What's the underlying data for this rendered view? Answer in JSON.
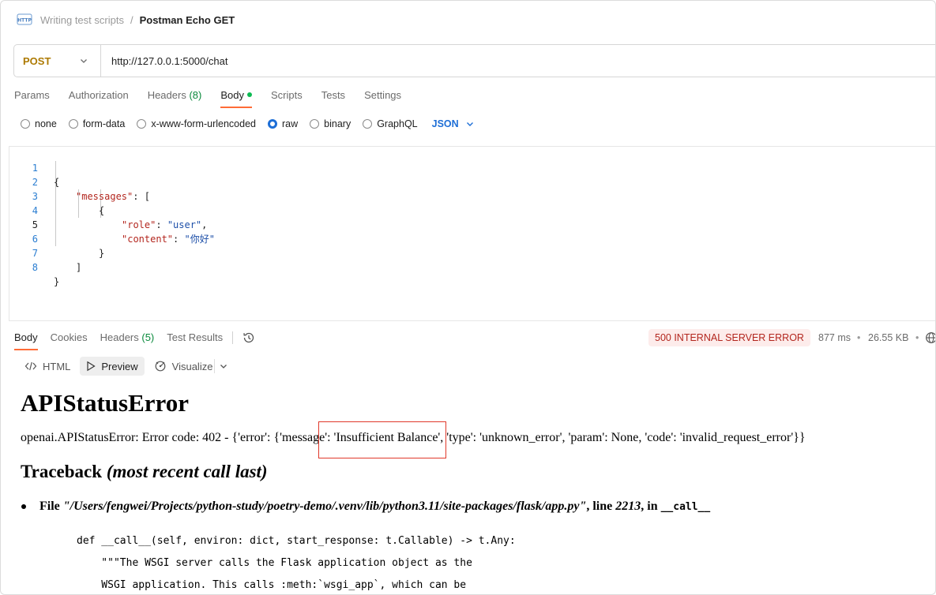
{
  "breadcrumb": {
    "icon": "http-request-icon",
    "collection": "Writing test scripts",
    "separator": "/",
    "request": "Postman Echo GET"
  },
  "request": {
    "method": "POST",
    "url": "http://127.0.0.1:5000/chat"
  },
  "request_tabs": [
    {
      "label": "Params"
    },
    {
      "label": "Authorization"
    },
    {
      "label": "Headers",
      "count": "(8)"
    },
    {
      "label": "Body",
      "active": true
    },
    {
      "label": "Scripts"
    },
    {
      "label": "Tests"
    },
    {
      "label": "Settings"
    }
  ],
  "body_types": [
    {
      "label": "none",
      "selected": false
    },
    {
      "label": "form-data",
      "selected": false
    },
    {
      "label": "x-www-form-urlencoded",
      "selected": false
    },
    {
      "label": "raw",
      "selected": true
    },
    {
      "label": "binary",
      "selected": false
    },
    {
      "label": "GraphQL",
      "selected": false
    }
  ],
  "raw_format": "JSON",
  "editor": {
    "lines": [
      {
        "n": "1",
        "text": "{"
      },
      {
        "n": "2",
        "key": "\"messages\"",
        "rest": ": ["
      },
      {
        "n": "3",
        "text": "{"
      },
      {
        "n": "4",
        "key": "\"role\"",
        "sep": ": ",
        "value": "\"user\"",
        "tail": ","
      },
      {
        "n": "5",
        "key": "\"content\"",
        "sep": ": ",
        "value": "\"你好\""
      },
      {
        "n": "6",
        "text": "}"
      },
      {
        "n": "7",
        "text": "]"
      },
      {
        "n": "8",
        "text": "}"
      }
    ]
  },
  "response_tabs": [
    {
      "label": "Body",
      "active": true
    },
    {
      "label": "Cookies"
    },
    {
      "label": "Headers",
      "count": "(5)"
    },
    {
      "label": "Test Results"
    }
  ],
  "response_status": {
    "status": "500 INTERNAL SERVER ERROR",
    "time": "877 ms",
    "size": "26.55 KB",
    "bullet": "•"
  },
  "view_modes": [
    {
      "label": "HTML",
      "icon": "code-icon"
    },
    {
      "label": "Preview",
      "icon": "play-icon",
      "active": true
    },
    {
      "label": "Visualize",
      "icon": "visualize-icon"
    }
  ],
  "preview": {
    "title": "APIStatusError",
    "message": "openai.APIStatusError: Error code: 402 - {'error': {'message': 'Insufficient Balance', 'type': 'unknown_error', 'param': None, 'code': 'invalid_request_error'}}",
    "traceback_heading": "Traceback",
    "traceback_note": "(most recent call last)",
    "file_prefix": "File ",
    "file_path": "\"/Users/fengwei/Projects/python-study/poetry-demo/.venv/lib/python3.11/site-packages/flask/app.py\"",
    "line_prefix": ", line ",
    "line_no": "2213",
    "in_prefix": ", in ",
    "func": "__call__",
    "code_lines": [
      "def __call__(self, environ: dict, start_response: t.Callable) -> t.Any:",
      "    \"\"\"The WSGI server calls the Flask application object as the",
      "    WSGI application. This calls :meth:`wsgi_app`, which can be"
    ]
  },
  "colors": {
    "method_post": "#ad7a03",
    "accent_tab": "#ff6c37",
    "status_error_bg": "#fdeceb",
    "status_error_fg": "#b3261e",
    "link_blue": "#1d6ed6",
    "highlight_box": "#e0392b"
  }
}
